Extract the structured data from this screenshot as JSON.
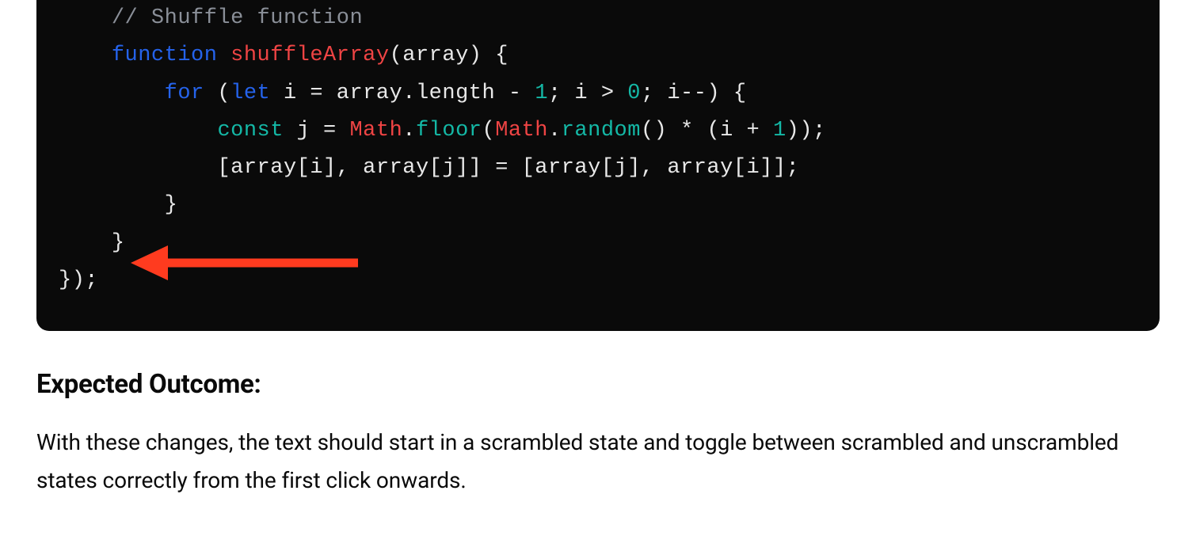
{
  "code": {
    "comment_shuffle": "// Shuffle function",
    "kw_function": "function",
    "fn_shuffleArray": "shuffleArray",
    "params_open": "(array) {",
    "kw_for": "for",
    "for_open": " (",
    "kw_let": "let",
    "for_var": " i = array.length - ",
    "num_1a": "1",
    "for_cond": "; i > ",
    "num_0": "0",
    "for_post": "; i--) {",
    "kw_const": "const",
    "const_assign": " j = ",
    "cls_math1": "Math",
    "dot1": ".",
    "m_floor": "floor",
    "paren_open": "(",
    "cls_math2": "Math",
    "dot2": ".",
    "m_random": "random",
    "rand_close": "() * (i + ",
    "num_1b": "1",
    "rand_end": "));",
    "swap_line": "[array[i], array[j]] = [array[j], array[i]];",
    "close_for": "    }",
    "close_fn": "}",
    "close_outer": "});"
  },
  "section": {
    "heading": "Expected Outcome:",
    "paragraph": "With these changes, the text should start in a scrambled state and toggle between scrambled and unscrambled states correctly from the first click onwards."
  },
  "annotation": {
    "arrow_color": "#ff3b1f"
  }
}
